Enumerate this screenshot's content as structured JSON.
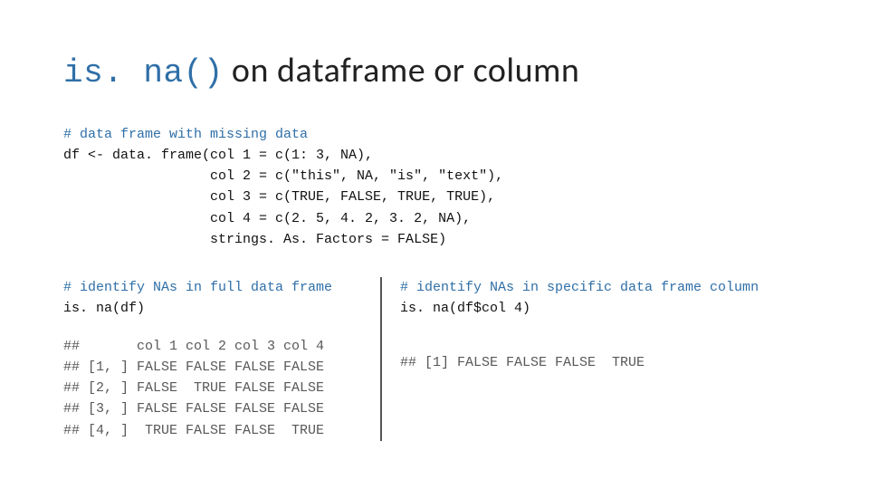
{
  "title": {
    "code_part": "is. na()",
    "plain_part": " on dataframe or column"
  },
  "top_block": {
    "comment": "# data frame with missing data",
    "code_lines": [
      "df <- data. frame(col 1 = c(1: 3, NA),",
      "                  col 2 = c(\"this\", NA, \"is\", \"text\"),",
      "                  col 3 = c(TRUE, FALSE, TRUE, TRUE),",
      "                  col 4 = c(2. 5, 4. 2, 3. 2, NA),",
      "                  strings. As. Factors = FALSE)"
    ]
  },
  "left": {
    "comment": "# identify NAs in full data frame",
    "code": "is. na(df)",
    "output_lines": [
      "##       col 1 col 2 col 3 col 4",
      "## [1, ] FALSE FALSE FALSE FALSE",
      "## [2, ] FALSE  TRUE FALSE FALSE",
      "## [3, ] FALSE FALSE FALSE FALSE",
      "## [4, ]  TRUE FALSE FALSE  TRUE"
    ]
  },
  "right": {
    "comment": "# identify NAs in specific data frame column",
    "code": "is. na(df$col 4)",
    "output": "## [1] FALSE FALSE FALSE  TRUE"
  }
}
